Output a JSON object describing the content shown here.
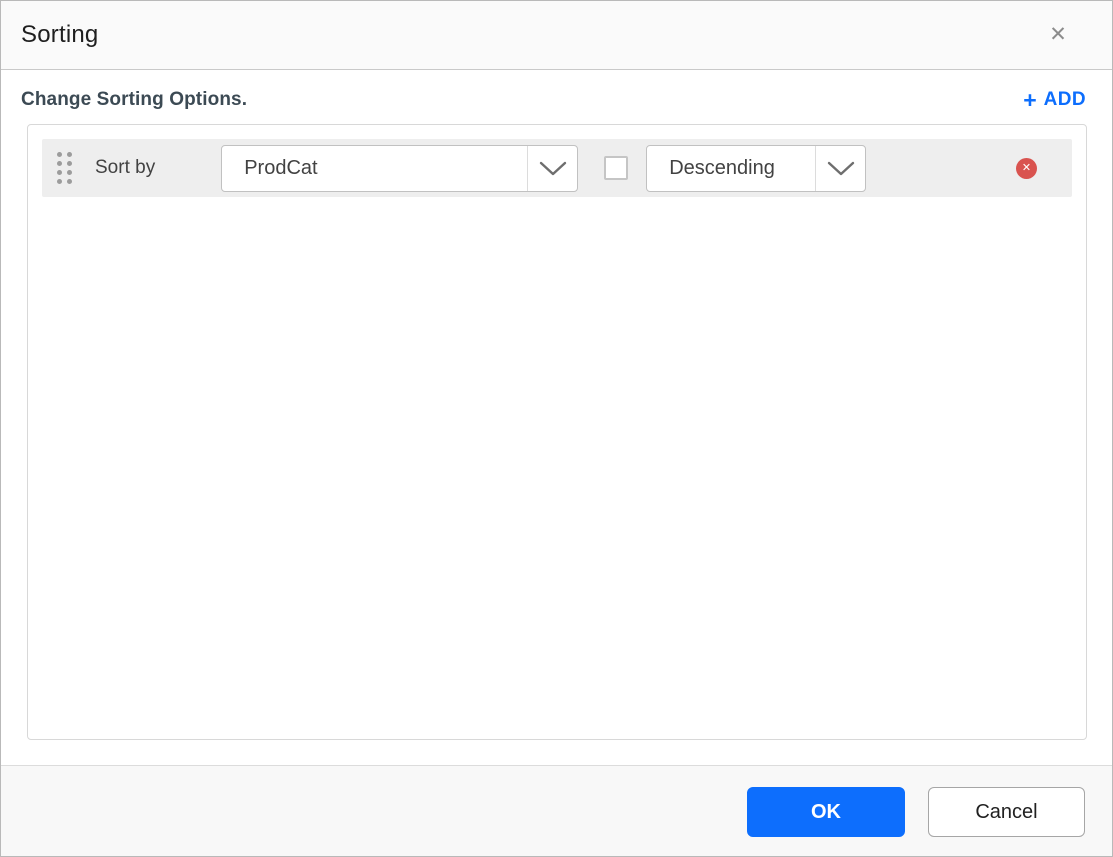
{
  "header": {
    "title": "Sorting",
    "close_icon": "✕"
  },
  "options": {
    "instruction": "Change Sorting Options.",
    "add_button": {
      "plus_icon": "+",
      "label": "ADD"
    }
  },
  "sort_rows": [
    {
      "drag_handle_icon": "grip-dots",
      "label": "Sort by",
      "field_dropdown": {
        "value": "ProdCat",
        "chevron_icon": "chevron-down"
      },
      "checkbox": {
        "checked": false
      },
      "direction_dropdown": {
        "value": "Descending",
        "chevron_icon": "chevron-down"
      },
      "delete_icon": "✕"
    }
  ],
  "footer": {
    "ok_label": "OK",
    "cancel_label": "Cancel"
  },
  "colors": {
    "accent_blue": "#0d6efd",
    "delete_red": "#d9534f",
    "row_background": "#eeeeee",
    "header_background": "#fafafa",
    "footer_background": "#f8f8f8",
    "heading_text": "#3c4a54",
    "body_text": "#424242"
  }
}
